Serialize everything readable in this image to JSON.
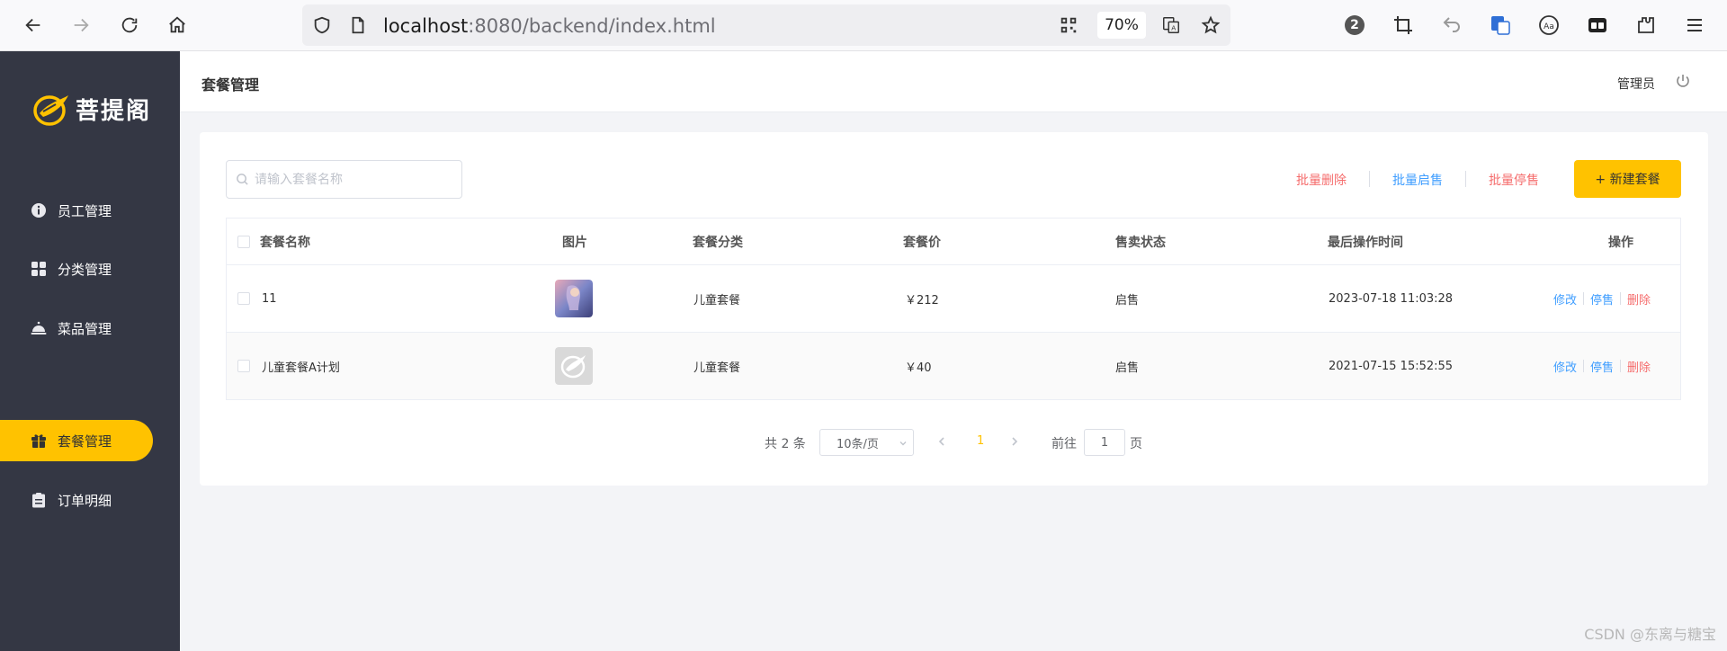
{
  "browser": {
    "url_host": "localhost",
    "url_rest": ":8080/backend/index.html",
    "zoom": "70%",
    "badge_count": "2"
  },
  "sidebar": {
    "brand": "菩提阁",
    "items": [
      {
        "label": "员工管理",
        "icon": "info-circle-icon"
      },
      {
        "label": "分类管理",
        "icon": "grid-icon"
      },
      {
        "label": "菜品管理",
        "icon": "dish-cover-icon"
      },
      {
        "label": "套餐管理",
        "icon": "gift-icon",
        "active": true
      },
      {
        "label": "订单明细",
        "icon": "clipboard-icon"
      }
    ]
  },
  "header": {
    "title": "套餐管理",
    "user": "管理员"
  },
  "toolbar": {
    "search_placeholder": "请输入套餐名称",
    "batch_delete": "批量删除",
    "batch_on_sale": "批量启售",
    "batch_off_sale": "批量停售",
    "new_button": "+ 新建套餐"
  },
  "table": {
    "columns": [
      "套餐名称",
      "图片",
      "套餐分类",
      "套餐价",
      "售卖状态",
      "最后操作时间",
      "操作"
    ],
    "rows": [
      {
        "name": "11",
        "category": "儿童套餐",
        "price": "￥212",
        "status": "启售",
        "updated": "2023-07-18 11:03:28"
      },
      {
        "name": "儿童套餐A计划",
        "category": "儿童套餐",
        "price": "￥40",
        "status": "启售",
        "updated": "2021-07-15 15:52:55"
      }
    ],
    "actions": {
      "edit": "修改",
      "toggle": "停售",
      "delete": "删除"
    }
  },
  "pagination": {
    "total": "共 2 条",
    "page_size": "10条/页",
    "current": "1",
    "goto_prefix": "前往",
    "goto_value": "1",
    "goto_suffix": "页"
  },
  "watermark": "CSDN @东离与糖宝",
  "colors": {
    "accent": "#ffc200",
    "sidebar": "#343744",
    "link_blue": "#409eff",
    "link_red": "#f56c6c"
  }
}
